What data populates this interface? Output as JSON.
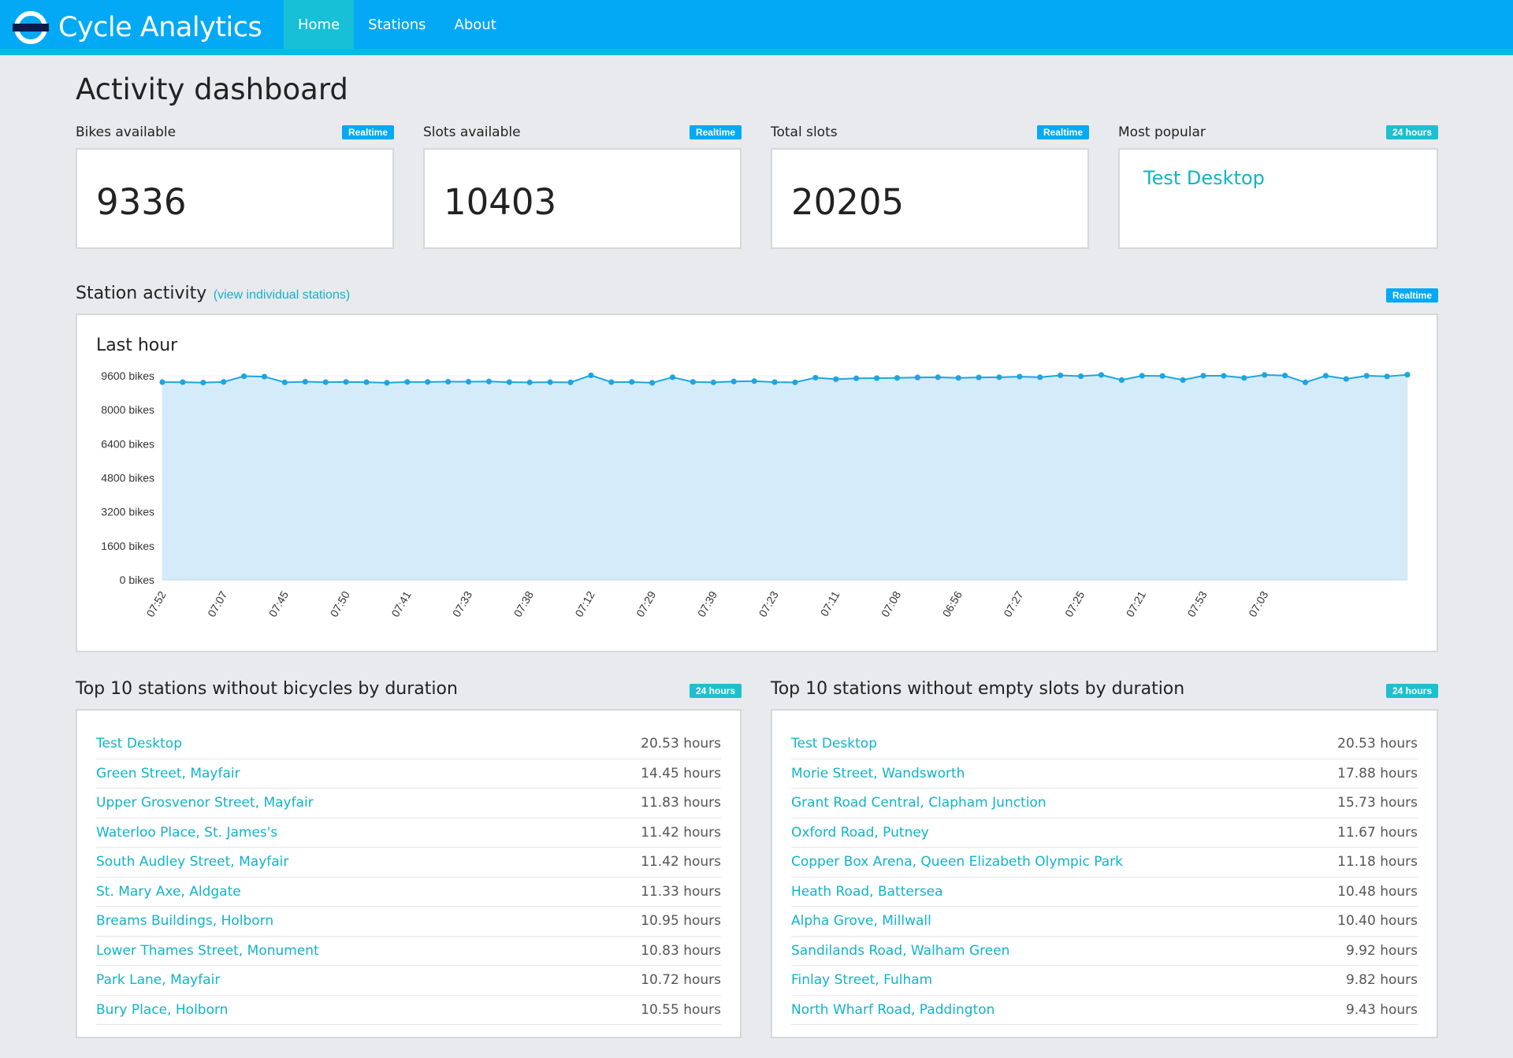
{
  "app": {
    "brand": "Cycle Analytics",
    "nav": [
      {
        "label": "Home",
        "active": true
      },
      {
        "label": "Stations",
        "active": false
      },
      {
        "label": "About",
        "active": false
      }
    ]
  },
  "page_title": "Activity dashboard",
  "stats": [
    {
      "label": "Bikes available",
      "badge": "Realtime",
      "value": "9336"
    },
    {
      "label": "Slots available",
      "badge": "Realtime",
      "value": "10403"
    },
    {
      "label": "Total slots",
      "badge": "Realtime",
      "value": "20205"
    },
    {
      "label": "Most popular",
      "badge": "24 hours",
      "value": "Test Desktop"
    }
  ],
  "station_activity": {
    "title": "Station activity",
    "link": "(view individual stations)",
    "badge": "Realtime",
    "chart_title": "Last hour"
  },
  "colors": {
    "navbar": "#03a9f4",
    "accent": "#11b3c9",
    "realtime_badge": "#03a9f4",
    "hours_badge": "#1fbfcf",
    "area_fill": "#cfeaf8",
    "line": "#1ea5e0"
  },
  "chart_data": {
    "type": "area",
    "title": "Last hour",
    "xlabel": "",
    "ylabel": "",
    "y_ticks": [
      "0 bikes",
      "1600 bikes",
      "3200 bikes",
      "4800 bikes",
      "6400 bikes",
      "8000 bikes",
      "9600 bikes"
    ],
    "ylim": [
      0,
      9600
    ],
    "x_tick_labels": [
      "07:52",
      "07:07",
      "07:45",
      "07:50",
      "07:41",
      "07:33",
      "07:38",
      "07:12",
      "07:29",
      "07:39",
      "07:23",
      "07:11",
      "07:08",
      "06:56",
      "07:27",
      "07:25",
      "07:21",
      "07:53",
      "07:03"
    ],
    "grid": true,
    "values": [
      9300,
      9300,
      9280,
      9310,
      9580,
      9560,
      9290,
      9320,
      9300,
      9310,
      9300,
      9270,
      9310,
      9310,
      9320,
      9320,
      9330,
      9300,
      9290,
      9300,
      9290,
      9620,
      9300,
      9310,
      9270,
      9530,
      9310,
      9290,
      9330,
      9350,
      9300,
      9290,
      9510,
      9440,
      9480,
      9490,
      9500,
      9520,
      9530,
      9500,
      9520,
      9530,
      9560,
      9530,
      9620,
      9580,
      9640,
      9400,
      9600,
      9590,
      9400,
      9600,
      9600,
      9500,
      9640,
      9610,
      9290,
      9600,
      9450,
      9600,
      9570,
      9650
    ]
  },
  "top_without_bikes": {
    "title": "Top 10 stations without bicycles by duration",
    "badge": "24 hours",
    "rows": [
      {
        "name": "Test Desktop",
        "value": "20.53 hours"
      },
      {
        "name": "Green Street, Mayfair",
        "value": "14.45 hours"
      },
      {
        "name": "Upper Grosvenor Street, Mayfair",
        "value": "11.83 hours"
      },
      {
        "name": "Waterloo Place, St. James's",
        "value": "11.42 hours"
      },
      {
        "name": "South Audley Street, Mayfair",
        "value": "11.42 hours"
      },
      {
        "name": "St. Mary Axe, Aldgate",
        "value": "11.33 hours"
      },
      {
        "name": "Breams Buildings, Holborn",
        "value": "10.95 hours"
      },
      {
        "name": "Lower Thames Street, Monument",
        "value": "10.83 hours"
      },
      {
        "name": "Park Lane, Mayfair",
        "value": "10.72 hours"
      },
      {
        "name": "Bury Place, Holborn",
        "value": "10.55 hours"
      }
    ]
  },
  "top_without_slots": {
    "title": "Top 10 stations without empty slots by duration",
    "badge": "24 hours",
    "rows": [
      {
        "name": "Test Desktop",
        "value": "20.53 hours"
      },
      {
        "name": "Morie Street, Wandsworth",
        "value": "17.88 hours"
      },
      {
        "name": "Grant Road Central, Clapham Junction",
        "value": "15.73 hours"
      },
      {
        "name": "Oxford Road, Putney",
        "value": "11.67 hours"
      },
      {
        "name": "Copper Box Arena, Queen Elizabeth Olympic Park",
        "value": "11.18 hours"
      },
      {
        "name": "Heath Road, Battersea",
        "value": "10.48 hours"
      },
      {
        "name": "Alpha Grove, Millwall",
        "value": "10.40 hours"
      },
      {
        "name": "Sandilands Road, Walham Green",
        "value": "9.92 hours"
      },
      {
        "name": "Finlay Street, Fulham",
        "value": "9.82 hours"
      },
      {
        "name": "North Wharf Road, Paddington",
        "value": "9.43 hours"
      }
    ]
  }
}
